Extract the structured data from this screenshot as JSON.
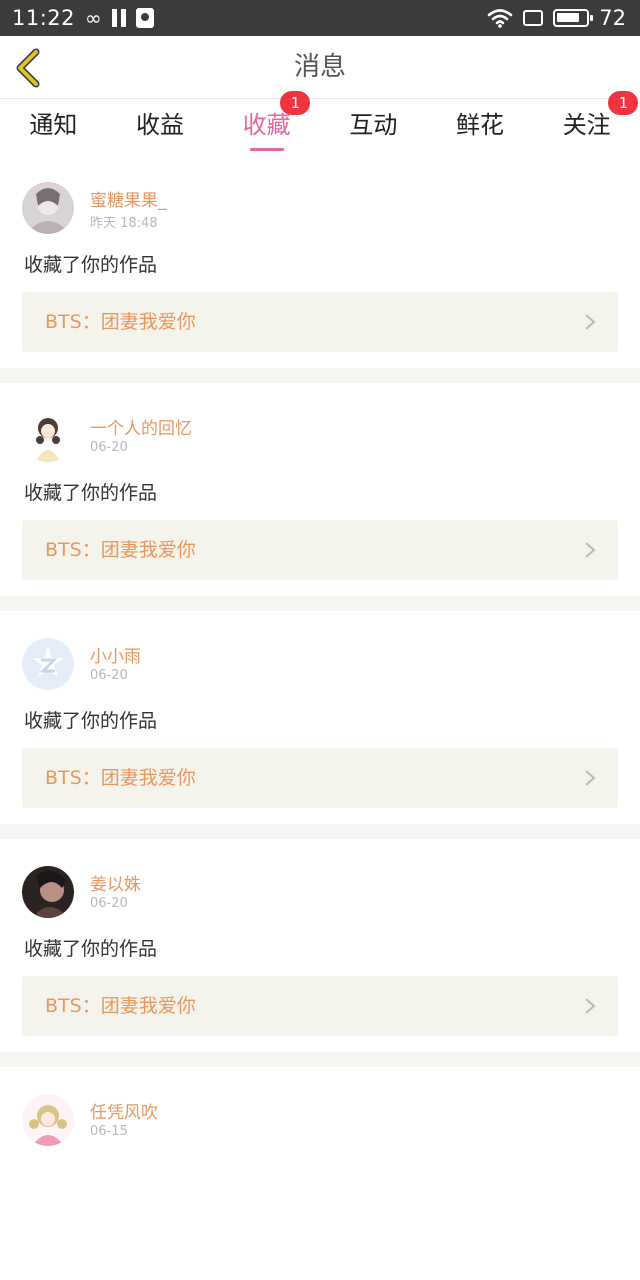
{
  "status_bar": {
    "time": "11:22",
    "infinity_glyph": "∞",
    "battery_level": "72",
    "icons": [
      "infinity-icon",
      "pause-icon",
      "notification-bag-icon",
      "wifi-icon",
      "screen-icon",
      "battery-icon"
    ]
  },
  "nav": {
    "title": "消息",
    "back_icon": "chevron-left-icon",
    "back_color": "#e0c22a"
  },
  "tabs": [
    {
      "label": "通知",
      "active": false,
      "badge": ""
    },
    {
      "label": "收益",
      "active": false,
      "badge": ""
    },
    {
      "label": "收藏",
      "active": true,
      "badge": "1"
    },
    {
      "label": "互动",
      "active": false,
      "badge": ""
    },
    {
      "label": "鲜花",
      "active": false,
      "badge": ""
    },
    {
      "label": "关注",
      "active": false,
      "badge": "1"
    }
  ],
  "colors": {
    "accent": "#e8669d",
    "badge": "#f1333f",
    "name": "#e9975f",
    "link_bg": "#f5f4ec"
  },
  "feed": [
    {
      "user": "蜜糖果果_",
      "time": "昨天 18:48",
      "action": "收藏了你的作品",
      "work": "BTS：团妻我爱你",
      "avatar": "photo-avatar-icon"
    },
    {
      "user": "一个人的回忆",
      "time": "06-20",
      "action": "收藏了你的作品",
      "work": "BTS：团妻我爱你",
      "avatar": "anime-girl-avatar-icon"
    },
    {
      "user": "小小雨",
      "time": "06-20",
      "action": "收藏了你的作品",
      "work": "BTS：团妻我爱你",
      "avatar": "qzone-avatar-icon"
    },
    {
      "user": "姜以姝",
      "time": "06-20",
      "action": "收藏了你的作品",
      "work": "BTS：团妻我爱你",
      "avatar": "dark-photo-avatar-icon"
    },
    {
      "user": "任凭风吹",
      "time": "06-15",
      "action": "",
      "work": "",
      "avatar": "pink-anime-avatar-icon"
    }
  ]
}
